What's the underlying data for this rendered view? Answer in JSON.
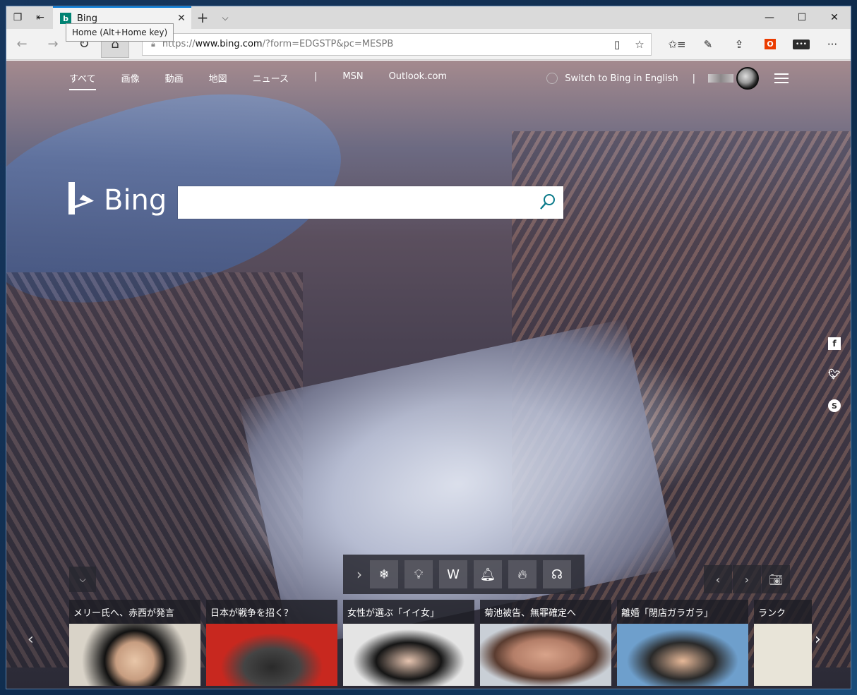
{
  "browser": {
    "tab_title": "Bing",
    "tab_close": "✕",
    "new_tab": "+",
    "tab_list": "⌵",
    "tooltip": "Home (Alt+Home key)",
    "url_prefix": "https://",
    "url_host": "www.bing.com",
    "url_rest": "/?form=EDGSTP&pc=MESPB",
    "window_buttons": {
      "minimize": "—",
      "maximize": "☐",
      "close": "✕"
    }
  },
  "nav": {
    "links": [
      "すべて",
      "画像",
      "動画",
      "地図",
      "ニュース"
    ],
    "separator": "|",
    "links2": [
      "MSN",
      "Outlook.com"
    ],
    "switch": "Switch to Bing in English",
    "right_sep": "|"
  },
  "logo_text": "Bing",
  "search": {
    "placeholder": ""
  },
  "news": [
    {
      "title": "メリー氏へ、赤西が発言",
      "bg": "#d9d3c8"
    },
    {
      "title": "日本が戦争を招く？",
      "bg": "#c8281f"
    },
    {
      "title": "女性が選ぶ「イイ女」",
      "bg": "#e4e4e4"
    },
    {
      "title": "菊池被告、無罪確定へ",
      "bg": "#c9cfd6"
    },
    {
      "title": "離婚「閉店ガラガラ」",
      "bg": "#6e9fcc"
    },
    {
      "title": "ランク",
      "bg": "#e8e4d8"
    }
  ],
  "colors": {
    "accent": "#0078d7",
    "bing_teal": "#008373",
    "office": "#eb3c00"
  }
}
